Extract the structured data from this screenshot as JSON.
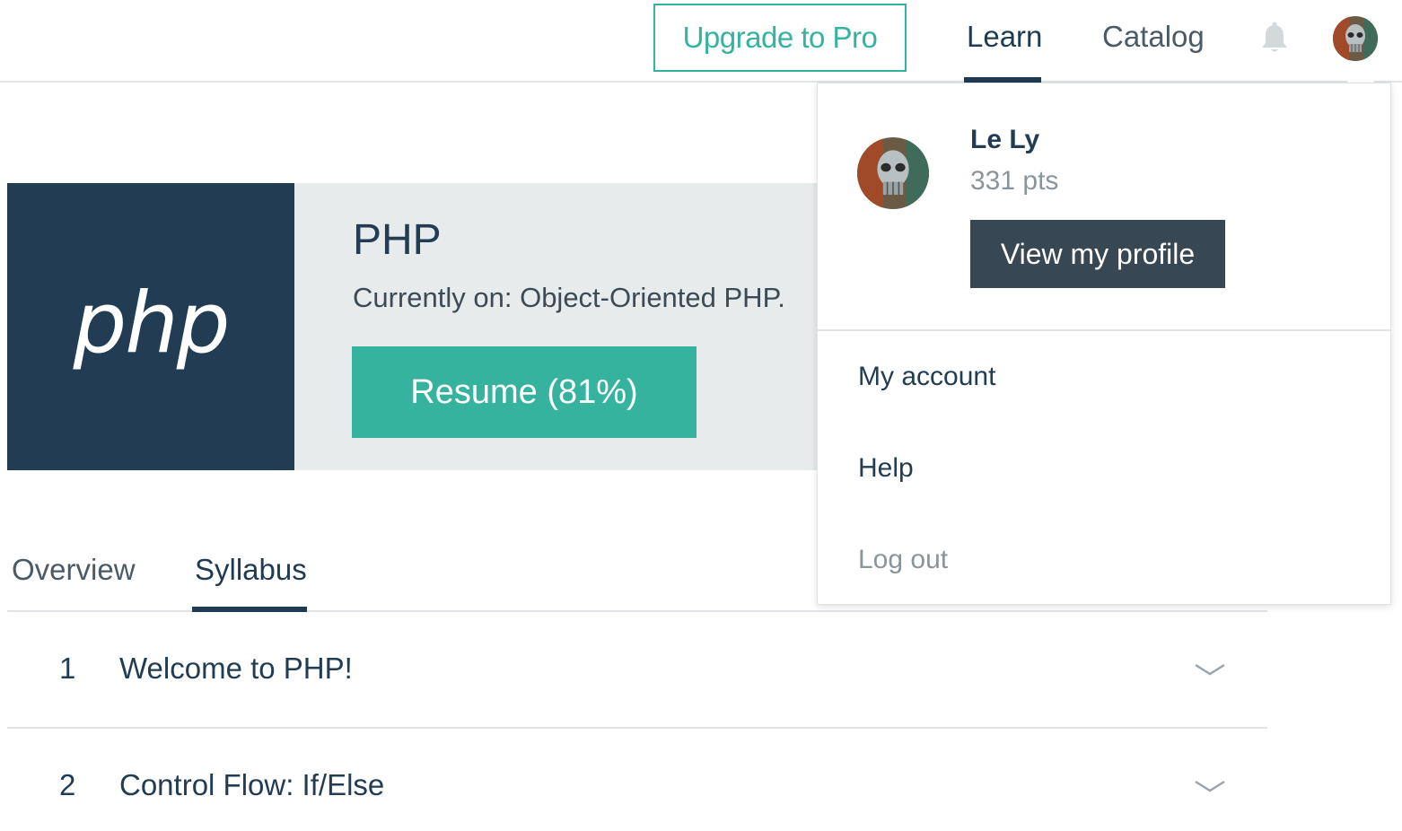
{
  "nav": {
    "upgrade_label": "Upgrade to Pro",
    "learn_label": "Learn",
    "catalog_label": "Catalog",
    "notifications_icon": "bell-icon",
    "accent_color": "#35b39f",
    "active_color": "#1f3b53"
  },
  "course": {
    "logo_text": "php",
    "title": "PHP",
    "current": "Currently on: Object-Oriented PHP.",
    "resume_label": "Resume (81%)",
    "progress_percent": 81
  },
  "tabs": [
    {
      "label": "Overview",
      "active": false
    },
    {
      "label": "Syllabus",
      "active": true
    }
  ],
  "syllabus": [
    {
      "number": "1",
      "title": "Welcome to PHP!"
    },
    {
      "number": "2",
      "title": "Control Flow: If/Else"
    }
  ],
  "user_menu": {
    "name": "Le Ly",
    "points": "331 pts",
    "view_profile_label": "View my profile",
    "items": [
      {
        "label": "My account"
      },
      {
        "label": "Help"
      },
      {
        "label": "Log out"
      }
    ]
  }
}
